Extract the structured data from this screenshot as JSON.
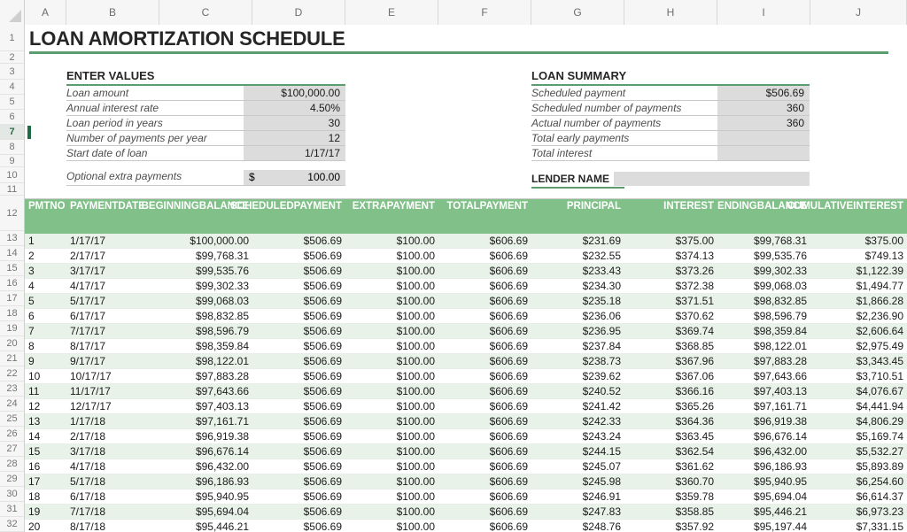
{
  "app": {
    "type": "spreadsheet",
    "accent_green": "#5d9c6f",
    "header_green": "#82c08a",
    "band_green": "#e8f2e9",
    "input_shade": "#dcdcdc"
  },
  "grid": {
    "column_headers": [
      "A",
      "B",
      "C",
      "D",
      "E",
      "F",
      "G",
      "H",
      "I",
      "J"
    ],
    "row_headers": [
      "1",
      "2",
      "3",
      "4",
      "5",
      "6",
      "7",
      "8",
      "9",
      "10",
      "11",
      "12",
      "13",
      "14",
      "15",
      "16",
      "17",
      "18",
      "19",
      "20",
      "21",
      "22",
      "23",
      "24",
      "25",
      "26",
      "27",
      "28",
      "29",
      "30",
      "31",
      "32"
    ],
    "selected_row": "7"
  },
  "title": "LOAN AMORTIZATION SCHEDULE",
  "enter_values": {
    "heading": "ENTER VALUES",
    "rows": [
      {
        "label": "Loan amount",
        "value": "$100,000.00"
      },
      {
        "label": "Annual interest rate",
        "value": "4.50%"
      },
      {
        "label": "Loan period in years",
        "value": "30"
      },
      {
        "label": "Number of payments per year",
        "value": "12"
      },
      {
        "label": "Start date of loan",
        "value": "1/17/17"
      }
    ],
    "optional": {
      "label": "Optional extra payments",
      "currency": "$",
      "value": "100.00"
    }
  },
  "loan_summary": {
    "heading": "LOAN SUMMARY",
    "rows": [
      {
        "label": "Scheduled payment",
        "value": "$506.69"
      },
      {
        "label": "Scheduled number of payments",
        "value": "360"
      },
      {
        "label": "Actual number of payments",
        "value": "360"
      },
      {
        "label": "Total early payments",
        "value": ""
      },
      {
        "label": "Total interest",
        "value": ""
      }
    ]
  },
  "lender": {
    "label": "LENDER NAME",
    "value": ""
  },
  "amortization_table": {
    "headers": [
      "PMT\nNO",
      "PAYMENT\nDATE",
      "BEGINNING\nBALANCE",
      "SCHEDULED\nPAYMENT",
      "EXTRA\nPAYMENT",
      "TOTAL\nPAYMENT",
      "PRINCIPAL",
      "INTEREST",
      "ENDING\nBALANCE",
      "CUMULATIVE\nINTEREST"
    ],
    "rows": [
      {
        "no": "1",
        "date": "1/17/17",
        "beginning": "$100,000.00",
        "scheduled": "$506.69",
        "extra": "$100.00",
        "total": "$606.69",
        "principal": "$231.69",
        "interest": "$375.00",
        "ending": "$99,768.31",
        "cumulative": "$375.00"
      },
      {
        "no": "2",
        "date": "2/17/17",
        "beginning": "$99,768.31",
        "scheduled": "$506.69",
        "extra": "$100.00",
        "total": "$606.69",
        "principal": "$232.55",
        "interest": "$374.13",
        "ending": "$99,535.76",
        "cumulative": "$749.13"
      },
      {
        "no": "3",
        "date": "3/17/17",
        "beginning": "$99,535.76",
        "scheduled": "$506.69",
        "extra": "$100.00",
        "total": "$606.69",
        "principal": "$233.43",
        "interest": "$373.26",
        "ending": "$99,302.33",
        "cumulative": "$1,122.39"
      },
      {
        "no": "4",
        "date": "4/17/17",
        "beginning": "$99,302.33",
        "scheduled": "$506.69",
        "extra": "$100.00",
        "total": "$606.69",
        "principal": "$234.30",
        "interest": "$372.38",
        "ending": "$99,068.03",
        "cumulative": "$1,494.77"
      },
      {
        "no": "5",
        "date": "5/17/17",
        "beginning": "$99,068.03",
        "scheduled": "$506.69",
        "extra": "$100.00",
        "total": "$606.69",
        "principal": "$235.18",
        "interest": "$371.51",
        "ending": "$98,832.85",
        "cumulative": "$1,866.28"
      },
      {
        "no": "6",
        "date": "6/17/17",
        "beginning": "$98,832.85",
        "scheduled": "$506.69",
        "extra": "$100.00",
        "total": "$606.69",
        "principal": "$236.06",
        "interest": "$370.62",
        "ending": "$98,596.79",
        "cumulative": "$2,236.90"
      },
      {
        "no": "7",
        "date": "7/17/17",
        "beginning": "$98,596.79",
        "scheduled": "$506.69",
        "extra": "$100.00",
        "total": "$606.69",
        "principal": "$236.95",
        "interest": "$369.74",
        "ending": "$98,359.84",
        "cumulative": "$2,606.64"
      },
      {
        "no": "8",
        "date": "8/17/17",
        "beginning": "$98,359.84",
        "scheduled": "$506.69",
        "extra": "$100.00",
        "total": "$606.69",
        "principal": "$237.84",
        "interest": "$368.85",
        "ending": "$98,122.01",
        "cumulative": "$2,975.49"
      },
      {
        "no": "9",
        "date": "9/17/17",
        "beginning": "$98,122.01",
        "scheduled": "$506.69",
        "extra": "$100.00",
        "total": "$606.69",
        "principal": "$238.73",
        "interest": "$367.96",
        "ending": "$97,883.28",
        "cumulative": "$3,343.45"
      },
      {
        "no": "10",
        "date": "10/17/17",
        "beginning": "$97,883.28",
        "scheduled": "$506.69",
        "extra": "$100.00",
        "total": "$606.69",
        "principal": "$239.62",
        "interest": "$367.06",
        "ending": "$97,643.66",
        "cumulative": "$3,710.51"
      },
      {
        "no": "11",
        "date": "11/17/17",
        "beginning": "$97,643.66",
        "scheduled": "$506.69",
        "extra": "$100.00",
        "total": "$606.69",
        "principal": "$240.52",
        "interest": "$366.16",
        "ending": "$97,403.13",
        "cumulative": "$4,076.67"
      },
      {
        "no": "12",
        "date": "12/17/17",
        "beginning": "$97,403.13",
        "scheduled": "$506.69",
        "extra": "$100.00",
        "total": "$606.69",
        "principal": "$241.42",
        "interest": "$365.26",
        "ending": "$97,161.71",
        "cumulative": "$4,441.94"
      },
      {
        "no": "13",
        "date": "1/17/18",
        "beginning": "$97,161.71",
        "scheduled": "$506.69",
        "extra": "$100.00",
        "total": "$606.69",
        "principal": "$242.33",
        "interest": "$364.36",
        "ending": "$96,919.38",
        "cumulative": "$4,806.29"
      },
      {
        "no": "14",
        "date": "2/17/18",
        "beginning": "$96,919.38",
        "scheduled": "$506.69",
        "extra": "$100.00",
        "total": "$606.69",
        "principal": "$243.24",
        "interest": "$363.45",
        "ending": "$96,676.14",
        "cumulative": "$5,169.74"
      },
      {
        "no": "15",
        "date": "3/17/18",
        "beginning": "$96,676.14",
        "scheduled": "$506.69",
        "extra": "$100.00",
        "total": "$606.69",
        "principal": "$244.15",
        "interest": "$362.54",
        "ending": "$96,432.00",
        "cumulative": "$5,532.27"
      },
      {
        "no": "16",
        "date": "4/17/18",
        "beginning": "$96,432.00",
        "scheduled": "$506.69",
        "extra": "$100.00",
        "total": "$606.69",
        "principal": "$245.07",
        "interest": "$361.62",
        "ending": "$96,186.93",
        "cumulative": "$5,893.89"
      },
      {
        "no": "17",
        "date": "5/17/18",
        "beginning": "$96,186.93",
        "scheduled": "$506.69",
        "extra": "$100.00",
        "total": "$606.69",
        "principal": "$245.98",
        "interest": "$360.70",
        "ending": "$95,940.95",
        "cumulative": "$6,254.60"
      },
      {
        "no": "18",
        "date": "6/17/18",
        "beginning": "$95,940.95",
        "scheduled": "$506.69",
        "extra": "$100.00",
        "total": "$606.69",
        "principal": "$246.91",
        "interest": "$359.78",
        "ending": "$95,694.04",
        "cumulative": "$6,614.37"
      },
      {
        "no": "19",
        "date": "7/17/18",
        "beginning": "$95,694.04",
        "scheduled": "$506.69",
        "extra": "$100.00",
        "total": "$606.69",
        "principal": "$247.83",
        "interest": "$358.85",
        "ending": "$95,446.21",
        "cumulative": "$6,973.23"
      },
      {
        "no": "20",
        "date": "8/17/18",
        "beginning": "$95,446.21",
        "scheduled": "$506.69",
        "extra": "$100.00",
        "total": "$606.69",
        "principal": "$248.76",
        "interest": "$357.92",
        "ending": "$95,197.44",
        "cumulative": "$7,331.15"
      }
    ]
  }
}
